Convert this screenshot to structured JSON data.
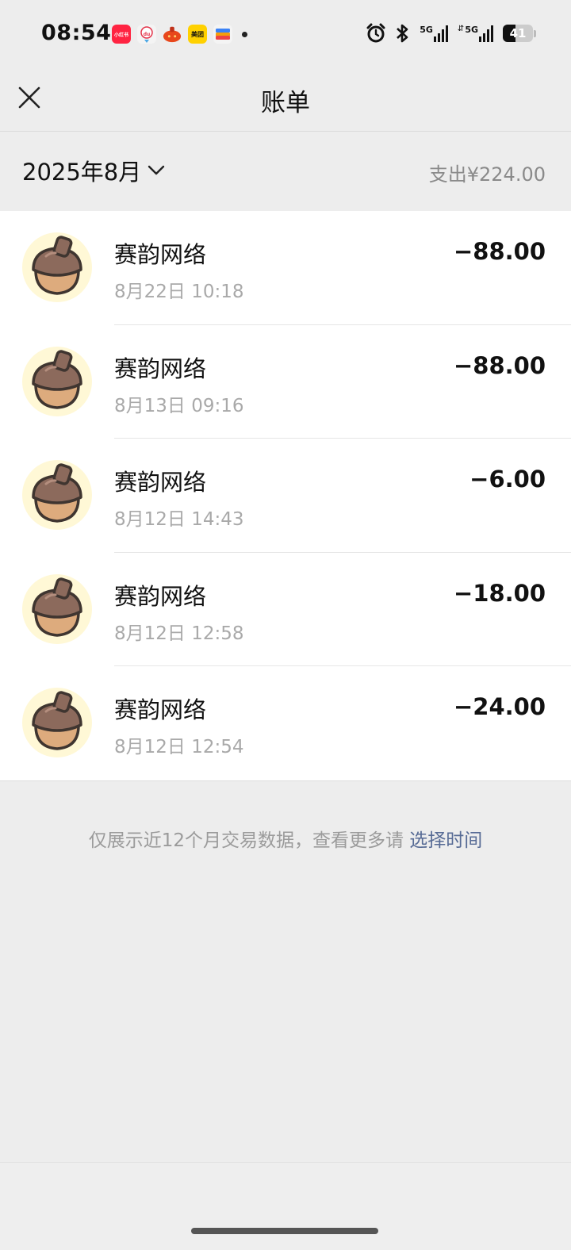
{
  "status_bar": {
    "time": "08:54",
    "apps": [
      {
        "name": "xiaohongshu-icon",
        "label": "小红书",
        "color": "#FF2442"
      },
      {
        "name": "dewu-icon",
        "label": "du",
        "color": "#F4F4F4"
      },
      {
        "name": "taobao-icon",
        "label": "",
        "color": "#E8471B"
      },
      {
        "name": "meituan-icon",
        "label": "美团",
        "color": "#FFD100"
      },
      {
        "name": "wallet-icon",
        "label": "",
        "color": "#F4F4F4"
      }
    ],
    "network_1": "5G",
    "network_2": "5G",
    "battery": "41",
    "battery_level": 0.41
  },
  "nav": {
    "title": "账单"
  },
  "filter": {
    "month": "2025年8月",
    "summary": "支出¥224.00"
  },
  "transactions": [
    {
      "merchant": "赛韵网络",
      "time": "8月22日 10:18",
      "amount": "−88.00"
    },
    {
      "merchant": "赛韵网络",
      "time": "8月13日 09:16",
      "amount": "−88.00"
    },
    {
      "merchant": "赛韵网络",
      "time": "8月12日 14:43",
      "amount": "−6.00"
    },
    {
      "merchant": "赛韵网络",
      "time": "8月12日 12:58",
      "amount": "−18.00"
    },
    {
      "merchant": "赛韵网络",
      "time": "8月12日 12:54",
      "amount": "−24.00"
    }
  ],
  "footer": {
    "note": "仅展示近12个月交易数据，查看更多请",
    "link": "选择时间"
  },
  "colors": {
    "background": "#EDEDED",
    "link": "#576B95",
    "avatar_bg": "#FFF8D6"
  }
}
